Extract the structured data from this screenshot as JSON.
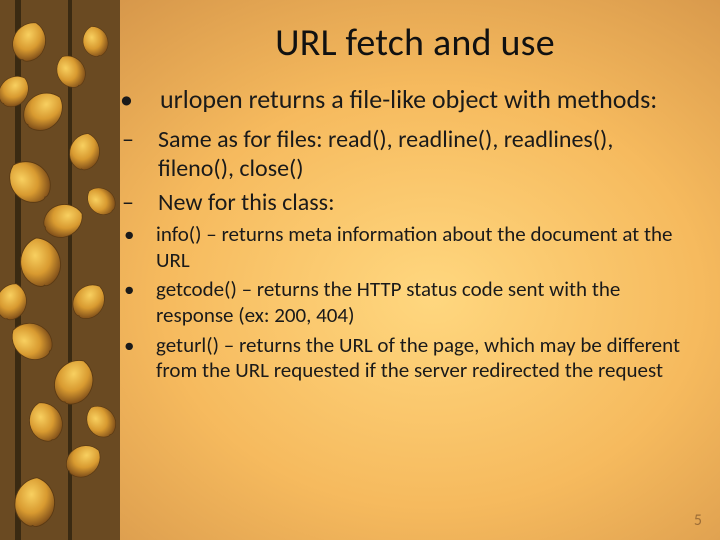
{
  "slide": {
    "title": "URL fetch and use",
    "slide_number": "5",
    "l1": {
      "bullet": "•",
      "text": "urlopen returns a file-like object with methods:"
    },
    "l2a": {
      "dash": "–",
      "text": "Same as for files: read(), readline(), readlines(), fileno(), close()"
    },
    "l2b": {
      "dash": "–",
      "text": "New for this class:"
    },
    "l3a": {
      "dot": "•",
      "text": "info() – returns meta information about the document at the URL"
    },
    "l3b": {
      "dot": "•",
      "text": "getcode() – returns the HTTP status code sent with the response (ex: 200, 404)"
    },
    "l3c": {
      "dot": "•",
      "text": "geturl() – returns the URL of the page, which may be different from the URL requested if the server redirected the request"
    }
  }
}
